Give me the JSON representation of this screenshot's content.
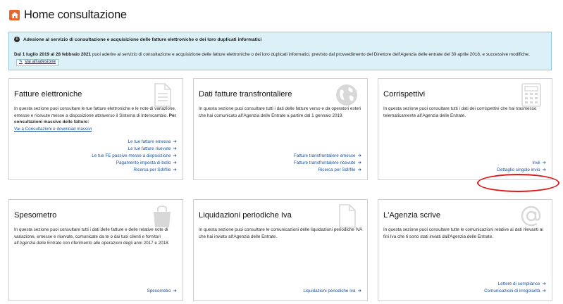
{
  "page": {
    "title": "Home consultazione"
  },
  "info": {
    "heading": "Adesione al servizio di consultazione e acquisizione delle fatture elettroniche o dei loro duplicati informatici",
    "dates": "Dal 1 luglio 2019 al 28 febbraio 2021",
    "text": " puoi aderire al servizio di consultazione e acquisizione delle fatture elettroniche o dei loro duplicati informatici, previsto dal provvedimento del Direttore dell'Agenzia delle entrate del 30 aprile 2018, e successive modifiche.",
    "button_label": "Vai all'adesione"
  },
  "cards": [
    {
      "title": "Fatture elettroniche",
      "icon": "document-icon",
      "description": "In questa sezione puoi consultare le tue fatture elettroniche e le note di variazione, emesse e ricevute messe a disposizione attraverso il Sistema di Interscambio.",
      "bold_text": "Per consultazioni massive delle fatture:",
      "link_text": "Vai a Consultazioni e download massivi",
      "links": [
        "Le tue fatture emesse",
        "Le tue fatture ricevute",
        "Le tue FE passive messe a disposizione",
        "Pagamento imposta di bollo",
        "Ricerca per SdI/file"
      ]
    },
    {
      "title": "Dati fatture transfrontaliere",
      "icon": "globe-icon",
      "description": "In questa sezione puoi consultare tutti i dati delle fatture verso e da operatori esteri che hai comunicato all'Agenzia delle Entrate a partire dal 1 gennaio 2019.",
      "links": [
        "Fatture transfrontaliere emesse",
        "Fatture transfrontaliere ricevute",
        "Ricerca per SdI/file"
      ]
    },
    {
      "title": "Corrispettivi",
      "icon": "calculator-icon",
      "description": "In questa sezione puoi consultare tutti i dati dei corrispettivi che hai trasmesso telematicamente all'Agenzia delle Entrate.",
      "links": [
        "Invii",
        "Dettaglio singolo invio"
      ]
    },
    {
      "title": "Spesometro",
      "icon": "shopping-bag-icon",
      "description": "In questa sezione puoi consultare tutti i dati delle fatture e delle relative note di variazione, emesse e ricevute, comunicate da te o dai tuoi clienti e fornitori all'Agenzia delle Entrate con riferimento alle operazioni degli anni 2017 e 2018.",
      "links": [
        "Spesometro"
      ]
    },
    {
      "title": "Liquidazioni periodiche Iva",
      "icon": "page-icon",
      "description": "In questa sezione puoi consultare le comunicazioni delle liquidazioni periodiche IVA che hai inviato all'Agenzia delle Entrate.",
      "links": [
        "Liquidazioni periodiche Iva"
      ]
    },
    {
      "title": "L'Agenzia scrive",
      "icon": "at-sign-icon",
      "description": "In questa sezione puoi consultare tutte le comunicazioni relative ai dati rilevanti ai fini Iva che ti sono stati inviati dall'Agenzia delle Entrate.",
      "links": [
        "Lettere di compliance",
        "Comunicazioni di irregolarità"
      ]
    }
  ],
  "colors": {
    "accent": "#e8662b",
    "link": "#1a4f9b",
    "info_bg": "#dcf0f7",
    "annotation": "#e01818"
  }
}
